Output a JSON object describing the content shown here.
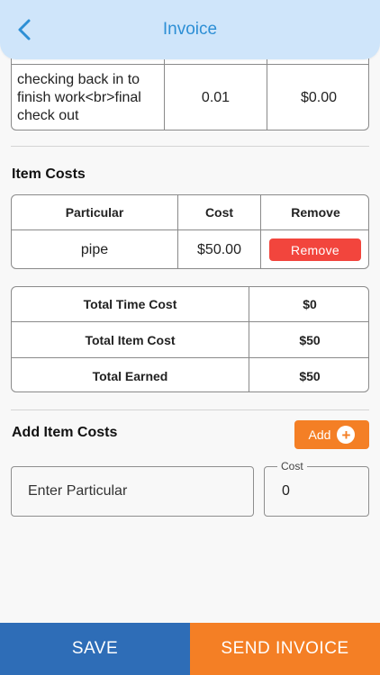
{
  "header": {
    "title": "Invoice"
  },
  "time_table": {
    "rows": [
      {
        "description": "checking back in to finish work<br>final check out",
        "hours": "0.01",
        "cost": "$0.00"
      }
    ]
  },
  "item_costs": {
    "title": "Item Costs",
    "headers": {
      "particular": "Particular",
      "cost": "Cost",
      "remove": "Remove"
    },
    "rows": [
      {
        "particular": "pipe",
        "cost": "$50.00",
        "remove_label": "Remove"
      }
    ]
  },
  "totals": [
    {
      "label": "Total Time Cost",
      "value": "$0"
    },
    {
      "label": "Total Item Cost",
      "value": "$50"
    },
    {
      "label": "Total Earned",
      "value": "$50"
    }
  ],
  "add_item": {
    "title": "Add Item Costs",
    "add_label": "Add",
    "particular_placeholder": "Enter Particular",
    "cost_label": "Cost",
    "cost_value": "0"
  },
  "footer": {
    "save_label": "SAVE",
    "send_label": "SEND INVOICE"
  },
  "colors": {
    "header_bg": "#cfe5fa",
    "accent_blue": "#2d8fd5",
    "save_bg": "#2e6db7",
    "send_bg": "#f47f25",
    "remove_bg": "#f2453d"
  }
}
